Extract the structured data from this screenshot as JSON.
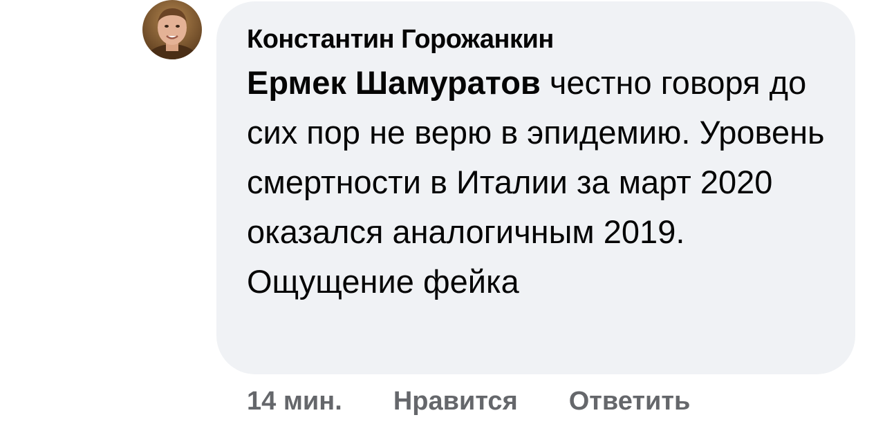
{
  "comment": {
    "author": "Константин Горожанкин",
    "mention": "Ермек Шамуратов",
    "text": " честно говоря до сих пор не верю в эпидемию. Уровень смертности в Италии за март 2020 оказался аналогичным 2019. Ощущение фейка",
    "avatar_icon": "user-avatar-photo",
    "bubble_color": "#f0f2f5"
  },
  "actions": {
    "time": "14 мин.",
    "like": "Нравится",
    "reply": "Ответить",
    "color": "#65676b"
  }
}
